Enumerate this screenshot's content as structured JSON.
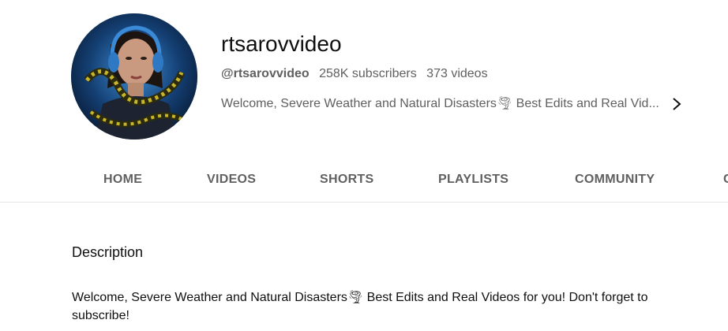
{
  "channel": {
    "name": "rtsarovvideo",
    "handle": "@rtsarovvideo",
    "subscribers": "258K subscribers",
    "videos": "373 videos",
    "about_preview": "Welcome, Severe Weather and Natural Disasters🌪 Best Edits and Real Vid...",
    "avatar_icon": "avatar-woman-with-snake"
  },
  "tabs": [
    {
      "label": "HOME"
    },
    {
      "label": "VIDEOS"
    },
    {
      "label": "SHORTS"
    },
    {
      "label": "PLAYLISTS"
    },
    {
      "label": "COMMUNITY"
    },
    {
      "label": "C"
    }
  ],
  "description": {
    "title": "Description",
    "body": "Welcome, Severe Weather and Natural Disasters🌪 Best Edits and Real Videos for you! Don't forget to subscribe!"
  },
  "colors": {
    "text_primary": "#0f0f0f",
    "text_secondary": "#606060",
    "divider": "#e5e5e5"
  }
}
